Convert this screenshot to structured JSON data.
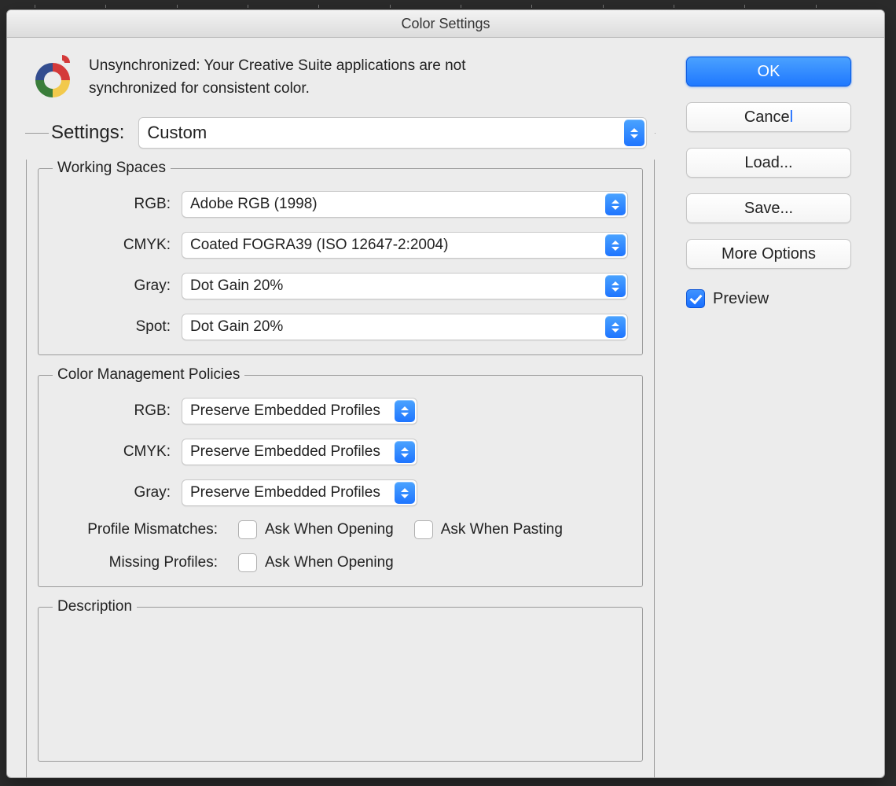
{
  "titlebar": {
    "title": "Color Settings"
  },
  "sync_message": "Unsynchronized: Your Creative Suite applications are not synchronized for consistent color.",
  "settings": {
    "label": "Settings:",
    "value": "Custom"
  },
  "working_spaces": {
    "legend": "Working Spaces",
    "rgb": {
      "label": "RGB:",
      "value": "Adobe RGB (1998)"
    },
    "cmyk": {
      "label": "CMYK:",
      "value": "Coated FOGRA39 (ISO 12647-2:2004)"
    },
    "gray": {
      "label": "Gray:",
      "value": "Dot Gain 20%"
    },
    "spot": {
      "label": "Spot:",
      "value": "Dot Gain 20%"
    }
  },
  "policies": {
    "legend": "Color Management Policies",
    "rgb": {
      "label": "RGB:",
      "value": "Preserve Embedded Profiles"
    },
    "cmyk": {
      "label": "CMYK:",
      "value": "Preserve Embedded Profiles"
    },
    "gray": {
      "label": "Gray:",
      "value": "Preserve Embedded Profiles"
    },
    "mismatch_label": "Profile Mismatches:",
    "mismatch_open": {
      "label": "Ask When Opening",
      "checked": false
    },
    "mismatch_paste": {
      "label": "Ask When Pasting",
      "checked": false
    },
    "missing_label": "Missing Profiles:",
    "missing_open": {
      "label": "Ask When Opening",
      "checked": false
    }
  },
  "description": {
    "legend": "Description"
  },
  "buttons": {
    "ok": "OK",
    "cancel": "Cancel",
    "load": "Load...",
    "save": "Save...",
    "more": "More Options"
  },
  "preview": {
    "label": "Preview",
    "checked": true
  }
}
